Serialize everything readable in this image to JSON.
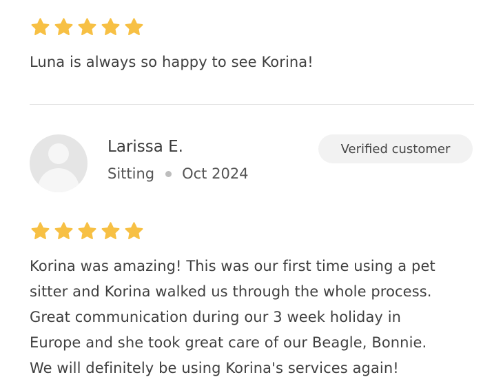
{
  "colors": {
    "star": "#F7C044",
    "divider": "#E3E3E3",
    "badge_bg": "#F2F2F2",
    "avatar_bg": "#E5E5E5"
  },
  "reviews": [
    {
      "rating": 5,
      "text": "Luna is always so happy to see Korina!"
    },
    {
      "avatar_icon": "default-user-avatar",
      "name": "Larissa E.",
      "service": "Sitting",
      "date": "Oct 2024",
      "badge": "Verified customer",
      "rating": 5,
      "text_lines": [
        "Korina was amazing! This was our first time using a pet",
        "sitter and Korina walked us through the whole process.",
        "Great communication during our 3 week holiday in",
        "Europe and she took great care of our Beagle, Bonnie.",
        "We will definitely be using Korina's services again!"
      ]
    }
  ]
}
